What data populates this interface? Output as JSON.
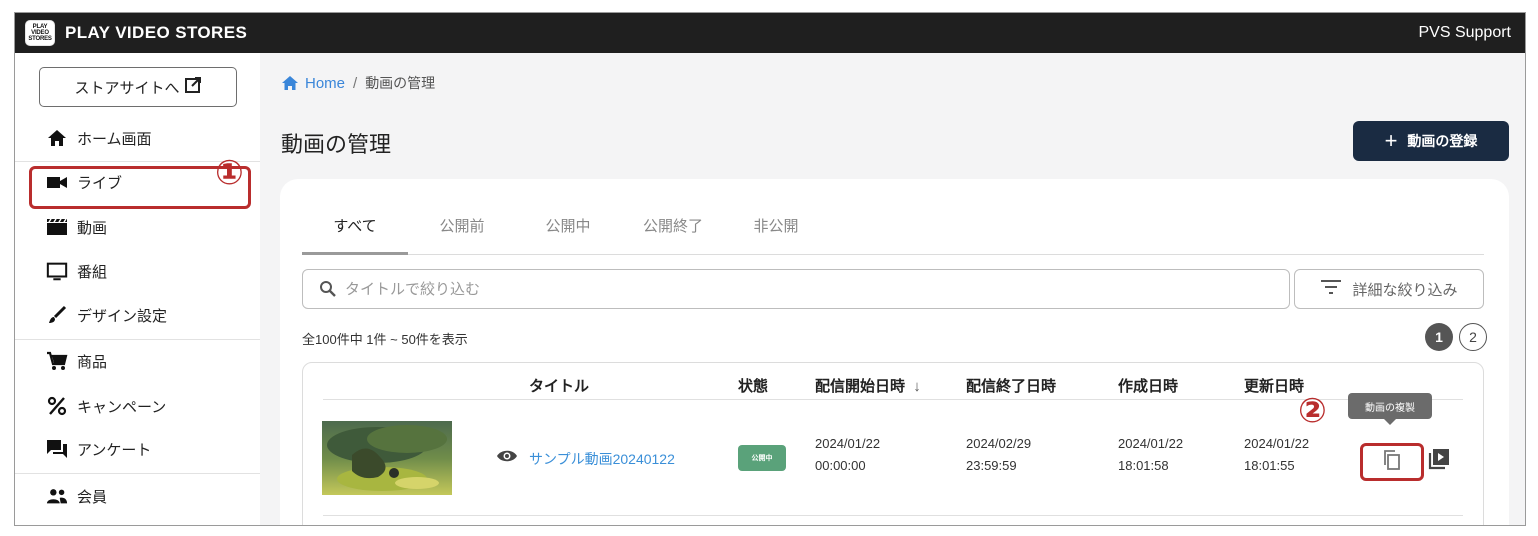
{
  "header": {
    "logo_lines": [
      "PLAY",
      "VIDEO",
      "STORES"
    ],
    "brand": "PLAY VIDEO STORES",
    "support": "PVS Support"
  },
  "sidebar": {
    "store_button": "ストアサイトへ",
    "items": [
      {
        "label": "ホーム画面",
        "icon": "home-icon"
      },
      {
        "label": "ライブ",
        "icon": "video-camera-icon"
      },
      {
        "label": "動画",
        "icon": "clapperboard-icon",
        "active": true
      },
      {
        "label": "番組",
        "icon": "tv-icon"
      },
      {
        "label": "デザイン設定",
        "icon": "brush-icon"
      },
      {
        "label": "商品",
        "icon": "cart-icon"
      },
      {
        "label": "キャンペーン",
        "icon": "percent-icon"
      },
      {
        "label": "アンケート",
        "icon": "chat-icon"
      },
      {
        "label": "会員",
        "icon": "people-icon"
      }
    ]
  },
  "annotations": {
    "one": "①",
    "two": "②"
  },
  "breadcrumb": {
    "home": "Home",
    "separator": "/",
    "current": "動画の管理"
  },
  "page": {
    "title": "動画の管理",
    "add_button": "動画の登録"
  },
  "tabs": [
    "すべて",
    "公開前",
    "公開中",
    "公開終了",
    "非公開"
  ],
  "search": {
    "placeholder": "タイトルで絞り込む",
    "filter_button": "詳細な絞り込み"
  },
  "list": {
    "count_text": "全100件中 1件 ~ 50件を表示",
    "pages": [
      "1",
      "2"
    ],
    "columns": [
      "タイトル",
      "状態",
      "配信開始日時",
      "配信終了日時",
      "作成日時",
      "更新日時"
    ],
    "sort_indicator": "↓",
    "rows": [
      {
        "title": "サンプル動画20240122",
        "status": "公開中",
        "start": [
          "2024/01/22",
          "00:00:00"
        ],
        "end": [
          "2024/02/29",
          "23:59:59"
        ],
        "created": [
          "2024/01/22",
          "18:01:58"
        ],
        "updated": [
          "2024/01/22",
          "18:01:55"
        ]
      }
    ],
    "tooltip": "動画の複製"
  },
  "colors": {
    "accent_red": "#b92d2d",
    "link_blue": "#3a8fd8",
    "status_green": "#5aa27a",
    "primary_navy": "#1a2b42"
  }
}
